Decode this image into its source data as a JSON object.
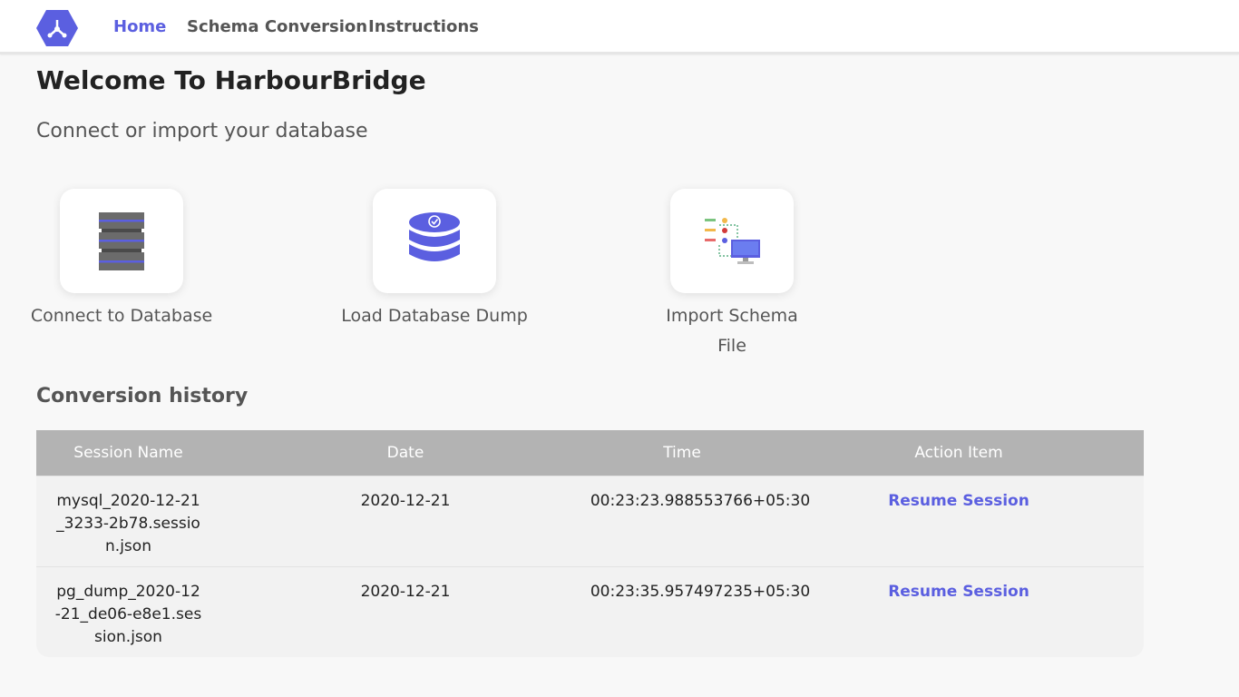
{
  "nav": {
    "items": [
      {
        "label": "Home",
        "active": true
      },
      {
        "label": "Schema Conversion",
        "active": false
      },
      {
        "label": "Instructions",
        "active": false
      }
    ],
    "logo_icon": "harbourbridge-hexagon-logo-icon"
  },
  "main": {
    "title": "Welcome To HarbourBridge",
    "subtitle": "Connect or import your database",
    "cards": [
      {
        "label": "Connect to Database",
        "icon": "server-stack-icon"
      },
      {
        "label": "Load Database Dump",
        "icon": "database-check-icon"
      },
      {
        "label": "Import Schema File",
        "icon": "schema-import-monitor-icon"
      }
    ]
  },
  "history": {
    "title": "Conversion history",
    "columns": [
      "Session Name",
      "Date",
      "Time",
      "Action Item"
    ],
    "rows": [
      {
        "session_name": "mysql_2020-12-21_3233-2b78.session.json",
        "date": "2020-12-21",
        "time": "00:23:23.988553766+05:30",
        "action": "Resume Session"
      },
      {
        "session_name": "pg_dump_2020-12-21_de06-e8e1.session.json",
        "date": "2020-12-21",
        "time": "00:23:35.957497235+05:30",
        "action": "Resume Session"
      }
    ]
  },
  "colors": {
    "accent": "#5b5fe0",
    "header_bg": "#b3b3b3",
    "table_bg": "#f2f2f2"
  }
}
